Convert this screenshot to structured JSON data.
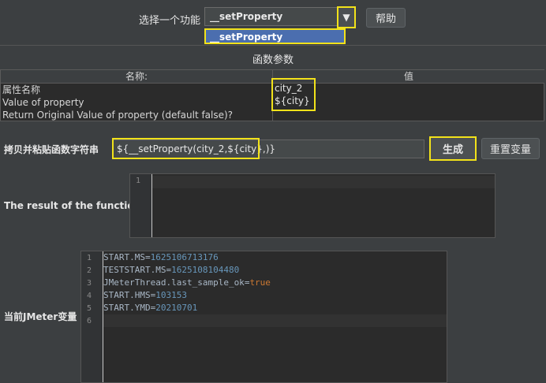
{
  "function_selector": {
    "label": "选择一个功能",
    "selected": "__setProperty",
    "dropdown_option": "__setProperty",
    "help_label": "帮助"
  },
  "params": {
    "title": "函数参数",
    "col_name": "名称:",
    "col_value": "值",
    "rows": [
      {
        "name": "属性名称",
        "value": "city_2"
      },
      {
        "name": "Value of property",
        "value": "${city}"
      },
      {
        "name": "Return Original Value of property (default false)?",
        "value": ""
      }
    ]
  },
  "copy": {
    "label": "拷贝并粘贴函数字符串",
    "value": "${__setProperty(city_2,${city},)}",
    "generate_label": "生成",
    "reset_label": "重置变量"
  },
  "result": {
    "label": "The result of the function is",
    "lines": [
      {
        "num": "1",
        "text": ""
      }
    ]
  },
  "vars": {
    "label": "当前JMeter变量",
    "lines": [
      {
        "num": "1",
        "key": "START.MS",
        "value": "1625106713176"
      },
      {
        "num": "2",
        "key": "TESTSTART.MS",
        "value": "1625108104480"
      },
      {
        "num": "3",
        "key": "JMeterThread.last_sample_ok",
        "value": "true"
      },
      {
        "num": "4",
        "key": "START.HMS",
        "value": "103153"
      },
      {
        "num": "5",
        "key": "START.YMD",
        "value": "20210701"
      },
      {
        "num": "6",
        "key": "",
        "value": ""
      }
    ]
  },
  "colors": {
    "background": "#3c3f41",
    "highlight": "#f2e21a",
    "selection": "#4b6eaf",
    "number": "#6897bb",
    "keyword": "#cc7832"
  }
}
